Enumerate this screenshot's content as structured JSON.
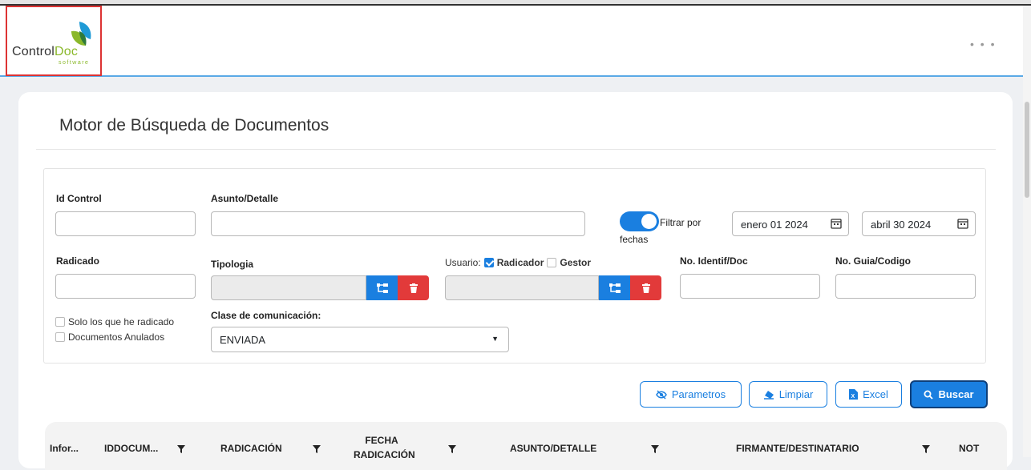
{
  "app": {
    "logo_text_1": "Control",
    "logo_text_2": "Doc",
    "logo_sub": "software",
    "menu_dots": "• • •"
  },
  "page": {
    "title": "Motor de Búsqueda de Documentos"
  },
  "filters": {
    "id_control_label": "Id Control",
    "asunto_label": "Asunto/Detalle",
    "filtrar_label_1": "Filtrar por",
    "filtrar_label_2": "fechas",
    "date_from": "enero 01 2024",
    "date_to": "abril 30 2024",
    "radicado_label": "Radicado",
    "tipologia_label": "Tipologia",
    "usuario_label": "Usuario:",
    "radicador_label": "Radicador",
    "gestor_label": "Gestor",
    "identif_label": "No. Identif/Doc",
    "guia_label": "No. Guia/Codigo",
    "solo_radicado_label": "Solo los que he radicado",
    "anulados_label": "Documentos Anulados",
    "clase_label": "Clase de comunicación:",
    "clase_value": "ENVIADA"
  },
  "actions": {
    "parametros": "Parametros",
    "limpiar": "Limpiar",
    "excel": "Excel",
    "buscar": "Buscar"
  },
  "table": {
    "columns": [
      "Infor...",
      "IDDOCUM...",
      "RADICACIÓN",
      "FECHA RADICACIÓN",
      "ASUNTO/DETALLE",
      "FIRMANTE/DESTINATARIO",
      "NOT"
    ]
  },
  "colors": {
    "primary": "#1a7fe0",
    "danger": "#e23a3a",
    "brand_green": "#8ab82a"
  }
}
